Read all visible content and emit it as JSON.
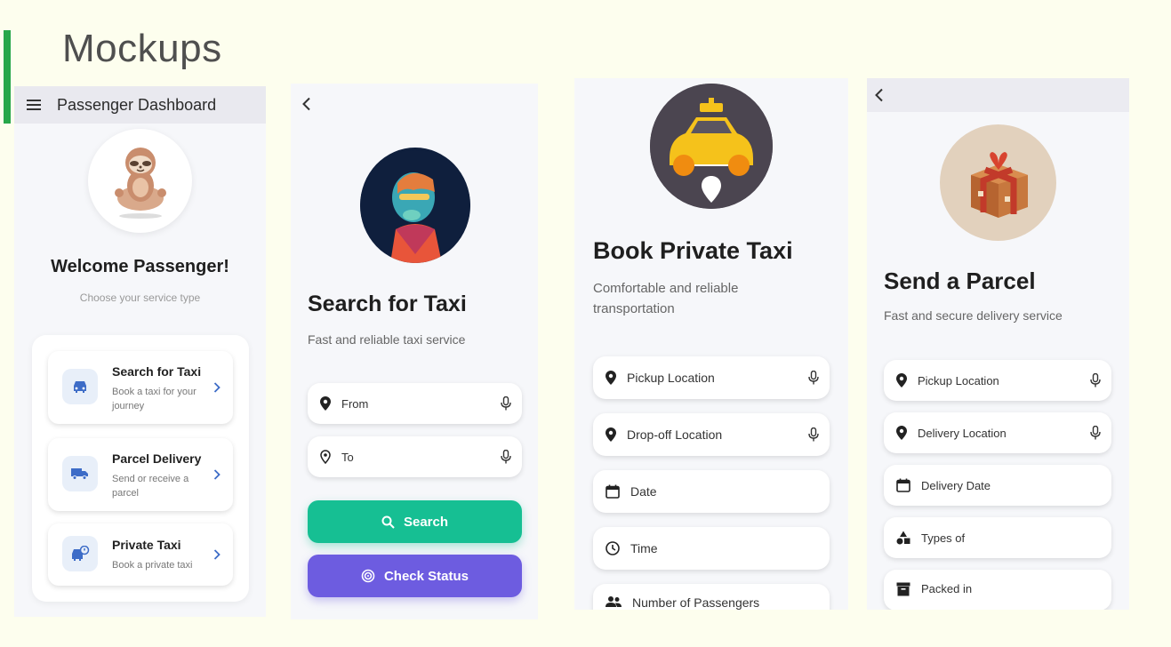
{
  "slide": {
    "title": "Mockups"
  },
  "dashboard": {
    "title": "Passenger Dashboard",
    "welcome": "Welcome Passenger!",
    "subtitle": "Choose your service type",
    "services": [
      {
        "title": "Search for Taxi",
        "desc": "Book a taxi for your journey",
        "icon": "car-icon"
      },
      {
        "title": "Parcel Delivery",
        "desc": "Send or receive a parcel",
        "icon": "truck-icon"
      },
      {
        "title": "Private Taxi",
        "desc": "Book a private taxi",
        "icon": "private-car-icon"
      }
    ]
  },
  "search": {
    "title": "Search for Taxi",
    "subtitle": "Fast and reliable taxi service",
    "from_placeholder": "From",
    "to_placeholder": "To",
    "search_label": "Search",
    "status_label": "Check Status"
  },
  "private": {
    "title": "Book Private Taxi",
    "subtitle_line1": "Comfortable and reliable",
    "subtitle_line2": "transportation",
    "pickup": "Pickup Location",
    "dropoff": "Drop-off Location",
    "date": "Date",
    "time": "Time",
    "passengers": "Number of Passengers"
  },
  "parcel": {
    "title": "Send a Parcel",
    "subtitle": "Fast and secure delivery service",
    "pickup": "Pickup Location",
    "delivery": "Delivery Location",
    "delivery_date": "Delivery Date",
    "types": "Types of",
    "packed": "Packed in"
  },
  "colors": {
    "green": "#16bf93",
    "purple": "#6d5ce0",
    "icon_blue": "#3d6cc7"
  }
}
